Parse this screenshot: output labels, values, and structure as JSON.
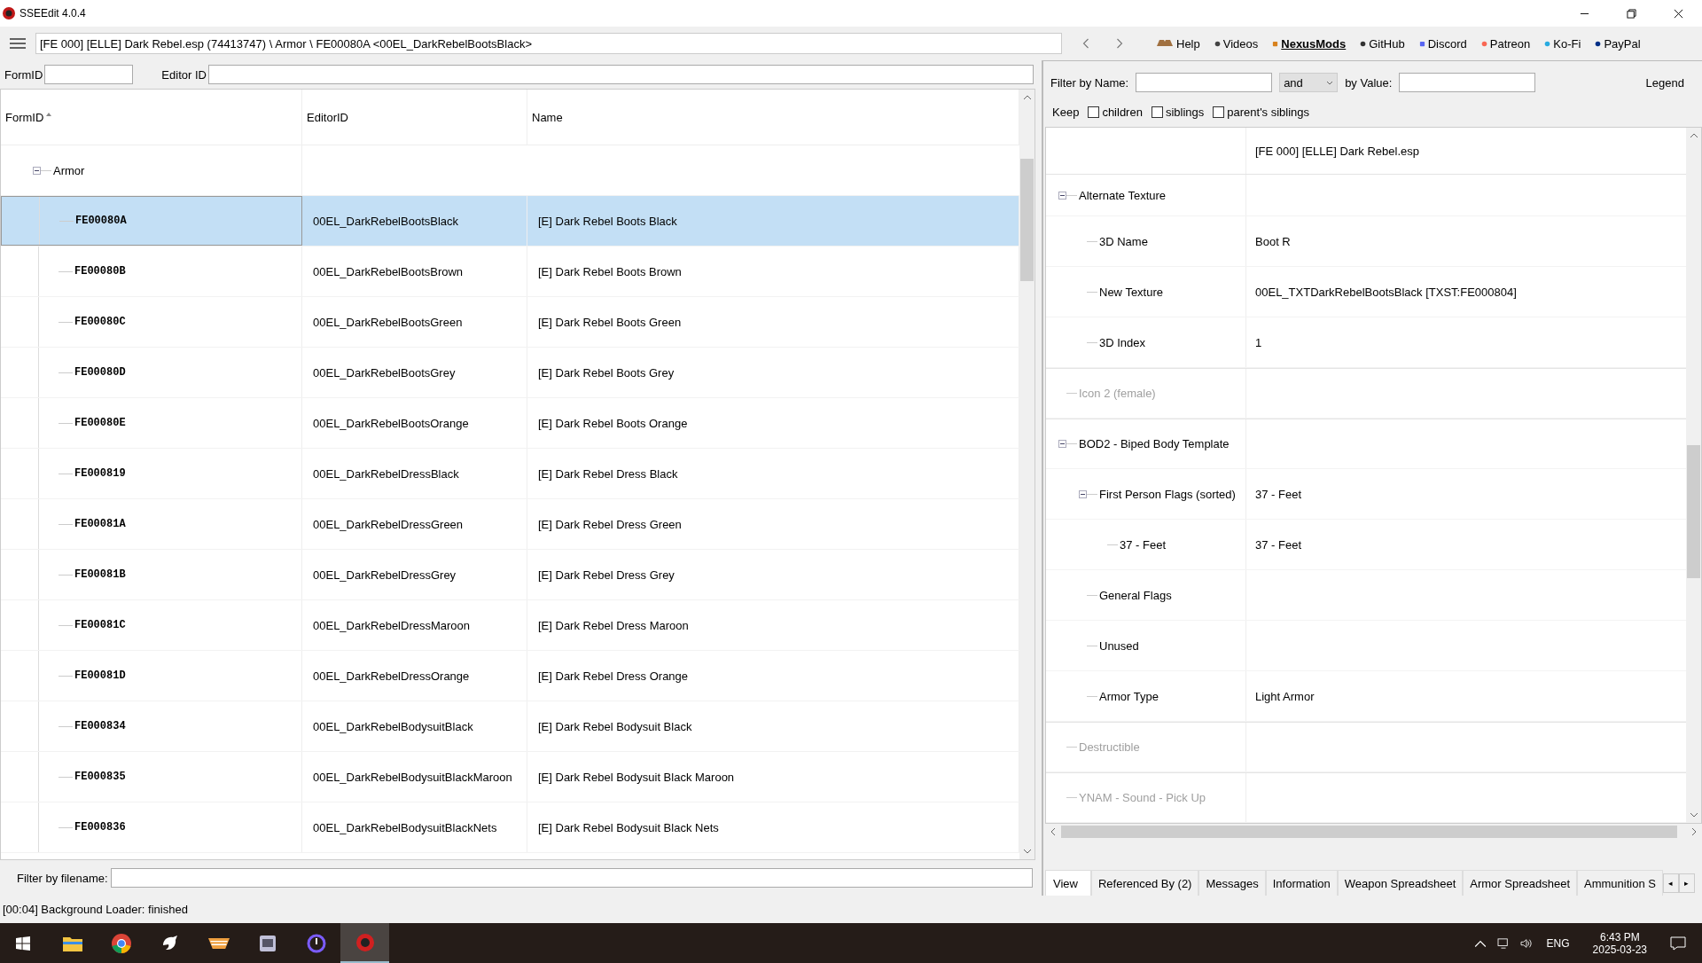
{
  "window": {
    "title": "SSEEdit 4.0.4"
  },
  "toolbar": {
    "path": "[FE 000] [ELLE] Dark Rebel.esp (74413747) \\ Armor \\ FE00080A <00EL_DarkRebelBootsBlack>",
    "links": [
      {
        "label": "Help",
        "kind": "book",
        "active": false
      },
      {
        "label": "Videos",
        "kind": "dot",
        "active": false
      },
      {
        "label": "NexusMods",
        "kind": "square",
        "active": true
      },
      {
        "label": "GitHub",
        "kind": "cat",
        "active": false
      },
      {
        "label": "Discord",
        "kind": "pad",
        "active": false
      },
      {
        "label": "Patreon",
        "kind": "circle",
        "active": false
      },
      {
        "label": "Ko-Fi",
        "kind": "cup",
        "active": false
      },
      {
        "label": "PayPal",
        "kind": "p",
        "active": false
      }
    ]
  },
  "left": {
    "formid_label": "FormID",
    "editorid_label": "Editor ID",
    "columns": [
      "FormID",
      "EditorID",
      "Name"
    ],
    "tree": [
      {
        "label": "Armor",
        "expanded": true,
        "children": [
          {
            "formid": "FE00080A",
            "editor_id": "00EL_DarkRebelBootsBlack",
            "name": "[E] Dark Rebel Boots Black",
            "selected": true
          },
          {
            "formid": "FE00080B",
            "editor_id": "00EL_DarkRebelBootsBrown",
            "name": "[E] Dark Rebel Boots Brown",
            "selected": false
          },
          {
            "formid": "FE00080C",
            "editor_id": "00EL_DarkRebelBootsGreen",
            "name": "[E] Dark Rebel Boots Green",
            "selected": false
          },
          {
            "formid": "FE00080D",
            "editor_id": "00EL_DarkRebelBootsGrey",
            "name": "[E] Dark Rebel Boots Grey",
            "selected": false
          },
          {
            "formid": "FE00080E",
            "editor_id": "00EL_DarkRebelBootsOrange",
            "name": "[E] Dark Rebel Boots Orange",
            "selected": false
          },
          {
            "formid": "FE000819",
            "editor_id": "00EL_DarkRebelDressBlack",
            "name": "[E] Dark Rebel Dress Black",
            "selected": false
          },
          {
            "formid": "FE00081A",
            "editor_id": "00EL_DarkRebelDressGreen",
            "name": "[E] Dark Rebel Dress Green",
            "selected": false
          },
          {
            "formid": "FE00081B",
            "editor_id": "00EL_DarkRebelDressGrey",
            "name": "[E] Dark Rebel Dress Grey",
            "selected": false
          },
          {
            "formid": "FE00081C",
            "editor_id": "00EL_DarkRebelDressMaroon",
            "name": "[E] Dark Rebel Dress Maroon",
            "selected": false
          },
          {
            "formid": "FE00081D",
            "editor_id": "00EL_DarkRebelDressOrange",
            "name": "[E] Dark Rebel Dress Orange",
            "selected": false
          },
          {
            "formid": "FE000834",
            "editor_id": "00EL_DarkRebelBodysuitBlack",
            "name": "[E] Dark Rebel Bodysuit Black",
            "selected": false
          },
          {
            "formid": "FE000835",
            "editor_id": "00EL_DarkRebelBodysuitBlackMaroon",
            "name": "[E] Dark Rebel Bodysuit Black Maroon",
            "selected": false
          },
          {
            "formid": "FE000836",
            "editor_id": "00EL_DarkRebelBodysuitBlackNets",
            "name": "[E] Dark Rebel Bodysuit Black Nets",
            "selected": false
          }
        ]
      }
    ],
    "filename_filter_label": "Filter by filename:"
  },
  "right": {
    "filter_name_label": "Filter by Name:",
    "operator": "and",
    "filter_value_label": "by Value:",
    "legend": "Legend",
    "keep_label": "Keep",
    "keep_options": [
      {
        "label": "children",
        "checked": false
      },
      {
        "label": "siblings",
        "checked": false
      },
      {
        "label": "parent's siblings",
        "checked": false
      }
    ],
    "file_header": "[FE 000] [ELLE] Dark Rebel.esp",
    "tree": [
      {
        "label": "Alternate Texture",
        "expanded": true,
        "disabled": false,
        "children": [
          {
            "label": "3D Name",
            "value": "Boot R",
            "disabled": false
          },
          {
            "label": "New Texture",
            "value": "00EL_TXTDarkRebelBootsBlack [TXST:FE000804]",
            "disabled": false
          },
          {
            "label": "3D Index",
            "value": "1",
            "disabled": false
          }
        ]
      },
      {
        "label": "Icon 2 (female)",
        "disabled": true
      },
      {
        "label": "BOD2 - Biped Body Template",
        "expanded": true,
        "disabled": false,
        "children": [
          {
            "label": "First Person Flags (sorted)",
            "value": "37 - Feet",
            "expanded": true,
            "disabled": false,
            "children": [
              {
                "label": "37 - Feet",
                "value": "37 - Feet",
                "disabled": false
              }
            ]
          },
          {
            "label": "General Flags",
            "disabled": false
          },
          {
            "label": "Unused",
            "disabled": false
          },
          {
            "label": "Armor Type",
            "value": "Light Armor",
            "disabled": false
          }
        ]
      },
      {
        "label": "Destructible",
        "disabled": true
      },
      {
        "label": "YNAM - Sound - Pick Up",
        "disabled": true
      }
    ],
    "tabs": [
      {
        "label": "View",
        "selected": true
      },
      {
        "label": "Referenced By (2)",
        "selected": false
      },
      {
        "label": "Messages",
        "selected": false
      },
      {
        "label": "Information",
        "selected": false
      },
      {
        "label": "Weapon Spreadsheet",
        "selected": false
      },
      {
        "label": "Armor Spreadsheet",
        "selected": false
      },
      {
        "label": "Ammunition S",
        "selected": false
      }
    ],
    "tab_scroll": [
      "◂",
      "▸"
    ]
  },
  "status_bar": "[00:04] Background Loader: finished",
  "taskbar": {
    "apps": [
      {
        "kind": "folder",
        "active": false
      },
      {
        "kind": "browser",
        "active": false
      },
      {
        "kind": "bird",
        "active": false
      },
      {
        "kind": "bowl",
        "active": false
      },
      {
        "kind": "box",
        "active": false
      },
      {
        "kind": "ring",
        "active": false
      },
      {
        "kind": "xedit",
        "active": true
      }
    ],
    "language": "ENG",
    "time": "6:43 PM",
    "date": "2025-03-23"
  }
}
